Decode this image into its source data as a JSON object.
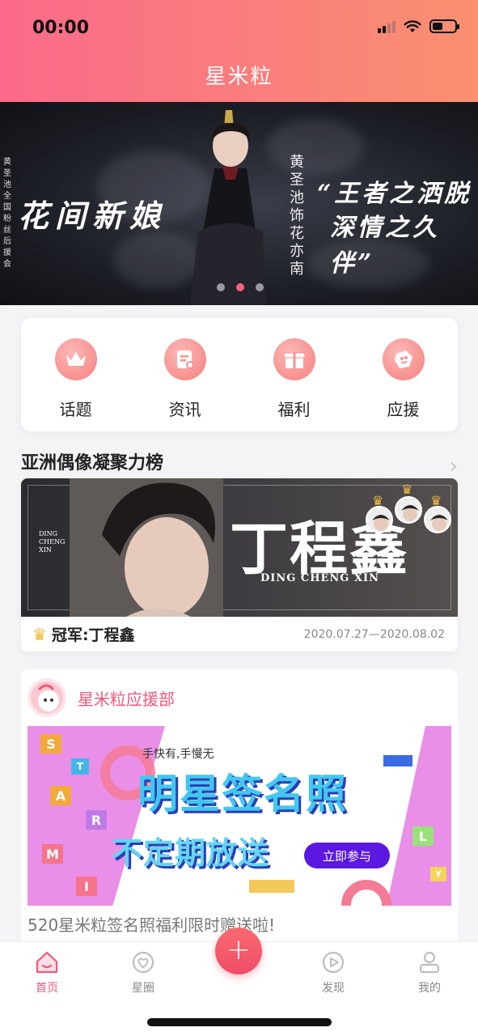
{
  "status": {
    "time": "00:00"
  },
  "header": {
    "title": "星米粒"
  },
  "banner": {
    "side_text": "黄圣池全国粉丝后援会",
    "headline": "花间新娘",
    "vertical": "黄圣池饰花亦南",
    "quote_line1": "“王者之洒脱",
    "quote_line2": "深情之久伴”",
    "dots": 3,
    "active_dot": 1
  },
  "quick_menu": [
    {
      "label": "话题",
      "icon": "crown-icon"
    },
    {
      "label": "资讯",
      "icon": "news-icon"
    },
    {
      "label": "福利",
      "icon": "gift-icon"
    },
    {
      "label": "应援",
      "icon": "heart-tag-icon"
    }
  ],
  "ranking": {
    "section_title": "亚洲偶像凝聚力榜",
    "poster_name": "丁程鑫",
    "poster_pinyin": "DING CHENG XIN",
    "poster_side": "DING CHENG XIN",
    "champion": "冠军:丁程鑫",
    "date_range": "2020.07.27—2020.08.02"
  },
  "support": {
    "name": "星米粒应援部",
    "poster_top": "手快有,手慢无",
    "poster_main": "明星签名照",
    "poster_sub": "不定期放送",
    "poster_button": "立即参与",
    "poster_letters": [
      "S",
      "T",
      "A",
      "R",
      "M",
      "I",
      "L",
      "Y"
    ],
    "caption": "520星米粒签名照福利限时赠送啦!"
  },
  "tabbar": [
    {
      "label": "首页",
      "icon": "home-icon",
      "active": true
    },
    {
      "label": "星圈",
      "icon": "star-circle-icon",
      "active": false
    },
    {
      "label": "发现",
      "icon": "discover-icon",
      "active": false
    },
    {
      "label": "我的",
      "icon": "profile-icon",
      "active": false
    }
  ],
  "colors": {
    "accent": "#f0577a",
    "header_start": "#fb6a8a",
    "header_end": "#f99070"
  }
}
